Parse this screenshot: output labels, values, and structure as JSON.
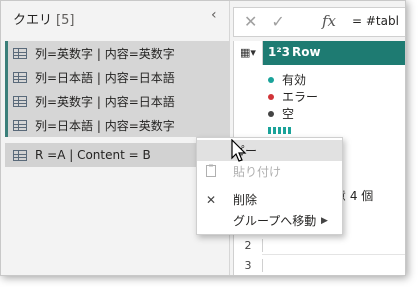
{
  "query_pane": {
    "title": "クエリ",
    "count": "[5]",
    "collapse_glyph": "‹",
    "items": [
      {
        "label": "列=英数字 | 内容=英数字"
      },
      {
        "label": "列=日本語 | 内容=日本語"
      },
      {
        "label": "列=英数字 | 内容=日本語"
      },
      {
        "label": "列=日本語 | 内容=英数字"
      },
      {
        "label": "R =A | Content = B"
      }
    ]
  },
  "formula_bar": {
    "cancel_glyph": "✕",
    "commit_glyph": "✓",
    "fx_label": "fx",
    "text": "= #tabl"
  },
  "grid": {
    "column_type": "1²3",
    "column_name": "Row",
    "quality": [
      {
        "label": "有効",
        "value": "100",
        "color": "#1aa39a"
      },
      {
        "label": "エラー",
        "value": "",
        "color": "#d13438"
      },
      {
        "label": "空",
        "value": "",
        "color": "#444444"
      }
    ],
    "distinct_text": "意 4 個",
    "row_numbers": [
      "2",
      "3"
    ]
  },
  "context_menu": {
    "items": [
      {
        "label": "ピー",
        "state": "hover"
      },
      {
        "label": "貼り付け",
        "state": "disabled"
      },
      {
        "label": "削除",
        "state": "normal"
      },
      {
        "label": "グループへ移動",
        "state": "normal",
        "submenu_glyph": "▶"
      }
    ]
  }
}
